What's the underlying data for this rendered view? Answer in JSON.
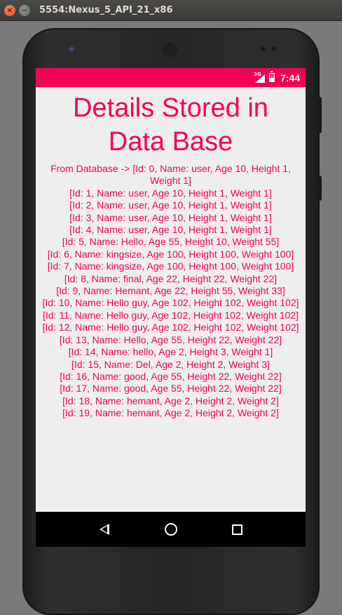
{
  "window": {
    "title": "5554:Nexus_5_API_21_x86",
    "close_glyph": "×",
    "minimize_glyph": "−"
  },
  "statusbar": {
    "network_label": "3G",
    "time": "7:44"
  },
  "screen": {
    "heading": "Details Stored in Data Base",
    "database_text": "From Database ->  [Id: 0, Name: user, Age 10, Height  1, Weight 1]\n[Id: 1, Name: user, Age 10, Height  1, Weight 1]\n[Id: 2, Name: user, Age 10, Height  1, Weight 1]\n[Id: 3, Name: user, Age 10, Height  1, Weight 1]\n[Id: 4, Name: user, Age 10, Height  1, Weight 1]\n[Id: 5, Name: Hello, Age 55, Height  10, Weight 55]\n[Id: 6, Name: kingsize, Age 100, Height  100, Weight 100]\n[Id: 7, Name: kingsize, Age 100, Height  100, Weight 100]\n[Id: 8, Name: final, Age 22, Height  22, Weight 22]\n[Id: 9, Name: Hemant, Age 22, Height  55, Weight 33]\n[Id: 10, Name: Hello guy, Age 102, Height  102, Weight 102]\n[Id: 11, Name: Hello guy, Age 102, Height  102, Weight 102]\n[Id: 12, Name: Hello guy, Age 102, Height  102, Weight 102]\n[Id: 13, Name: Hello, Age 55, Height  22, Weight 22]\n[Id: 14, Name: hello, Age 2, Height  3, Weight 1]\n[Id: 15, Name: Del, Age 2, Height  2, Weight 3]\n[Id: 16, Name: good, Age 55, Height  22, Weight 22]\n[Id: 17, Name: good, Age 55, Height  22, Weight 22]\n[Id: 18, Name: hemant, Age 2, Height  2, Weight 2]\n[Id: 19, Name: hemant, Age 2, Height  2, Weight 2]"
  },
  "navbar": {
    "icons": [
      "back-icon",
      "home-icon",
      "recents-icon"
    ]
  },
  "colors": {
    "accent": "#f50057",
    "screen_background": "#eeeeee",
    "navbar": "#000000"
  }
}
